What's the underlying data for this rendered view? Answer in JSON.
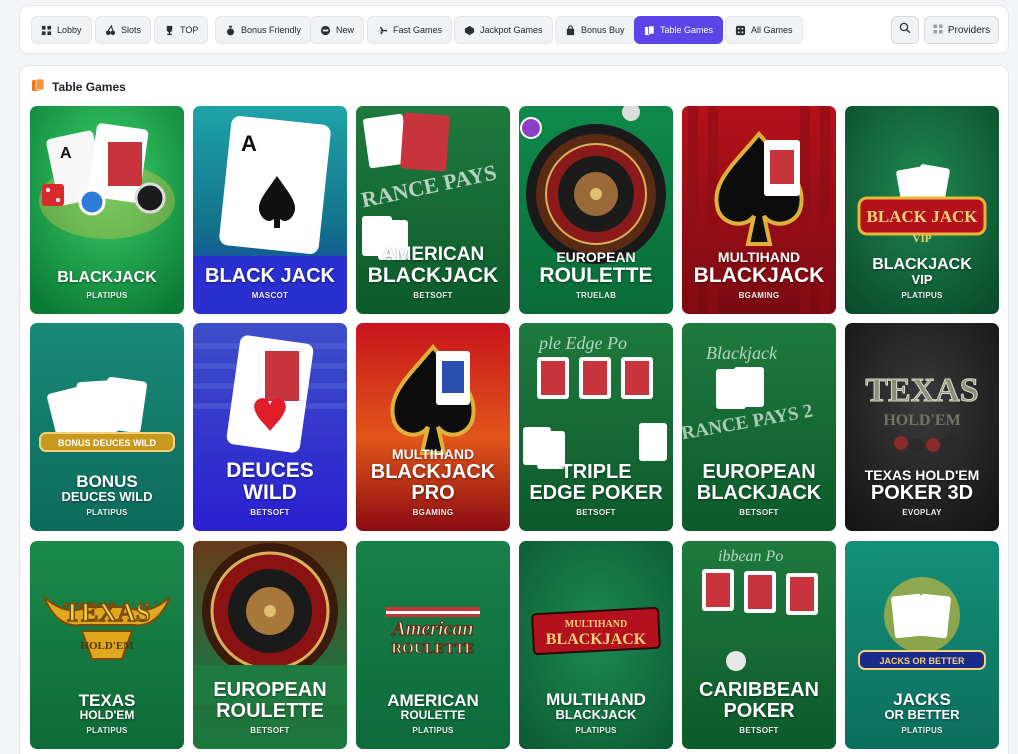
{
  "nav": {
    "tabs": [
      {
        "label": "Lobby",
        "icon": "lobby-grid-icon",
        "active": false
      },
      {
        "label": "Slots",
        "icon": "cherries-icon",
        "active": false
      },
      {
        "label": "TOP",
        "icon": "trophy-icon",
        "active": false
      },
      {
        "label": "Bonus Friendly",
        "icon": "money-bag-icon",
        "active": false
      },
      {
        "label": "New",
        "icon": "new-badge-icon",
        "active": false
      },
      {
        "label": "Fast Games",
        "icon": "airplane-icon",
        "active": false
      },
      {
        "label": "Jackpot Games",
        "icon": "jackpot-diamond-icon",
        "active": false
      },
      {
        "label": "Bonus Buy",
        "icon": "shopping-bag-icon",
        "active": false
      },
      {
        "label": "Table Games",
        "icon": "cards-icon",
        "active": true
      },
      {
        "label": "All Games",
        "icon": "dice-icon",
        "active": false
      }
    ],
    "providers_label": "Providers"
  },
  "section": {
    "title": "Table Games",
    "icon": "table-games-icon"
  },
  "games": [
    {
      "l1": "BLACKJACK",
      "l2": "",
      "provider": "PLATIPUS"
    },
    {
      "l1": "BLACK JACK",
      "l2": "",
      "provider": "MASCOT"
    },
    {
      "l1": "AMERICAN",
      "l2": "BLACKJACK",
      "provider": "BETSOFT"
    },
    {
      "l1": "EUROPEAN",
      "l2": "ROULETTE",
      "provider": "TRUELAB"
    },
    {
      "l1": "MULTIHAND",
      "l2": "BLACKJACK",
      "provider": "BGAMING"
    },
    {
      "l1": "BLACKJACK",
      "l2": "VIP",
      "provider": "PLATIPUS"
    },
    {
      "l1": "BONUS",
      "l2": "DEUCES WILD",
      "provider": "PLATIPUS"
    },
    {
      "l1": "DEUCES",
      "l2": "WILD",
      "provider": "BETSOFT"
    },
    {
      "l1": "MULTIHAND",
      "l2": "BLACKJACK PRO",
      "provider": "BGAMING"
    },
    {
      "l1": "TRIPLE",
      "l2": "EDGE POKER",
      "provider": "BETSOFT"
    },
    {
      "l1": "EUROPEAN",
      "l2": "BLACKJACK",
      "provider": "BETSOFT"
    },
    {
      "l1": "TEXAS HOLD'EM",
      "l2": "POKER 3D",
      "provider": "EVOPLAY"
    },
    {
      "l1": "TEXAS",
      "l2": "HOLD'EM",
      "provider": "PLATIPUS"
    },
    {
      "l1": "EUROPEAN",
      "l2": "ROULETTE",
      "provider": "BETSOFT"
    },
    {
      "l1": "AMERICAN",
      "l2": "ROULETTE",
      "provider": "PLATIPUS"
    },
    {
      "l1": "MULTIHAND",
      "l2": "BLACKJACK",
      "provider": "PLATIPUS"
    },
    {
      "l1": "CARIBBEAN",
      "l2": "POKER",
      "provider": "BETSOFT"
    },
    {
      "l1": "JACKS",
      "l2": "OR BETTER",
      "provider": "PLATIPUS"
    }
  ],
  "colors": {
    "accent": "#5b45e8",
    "section_icon": "#f97316"
  }
}
